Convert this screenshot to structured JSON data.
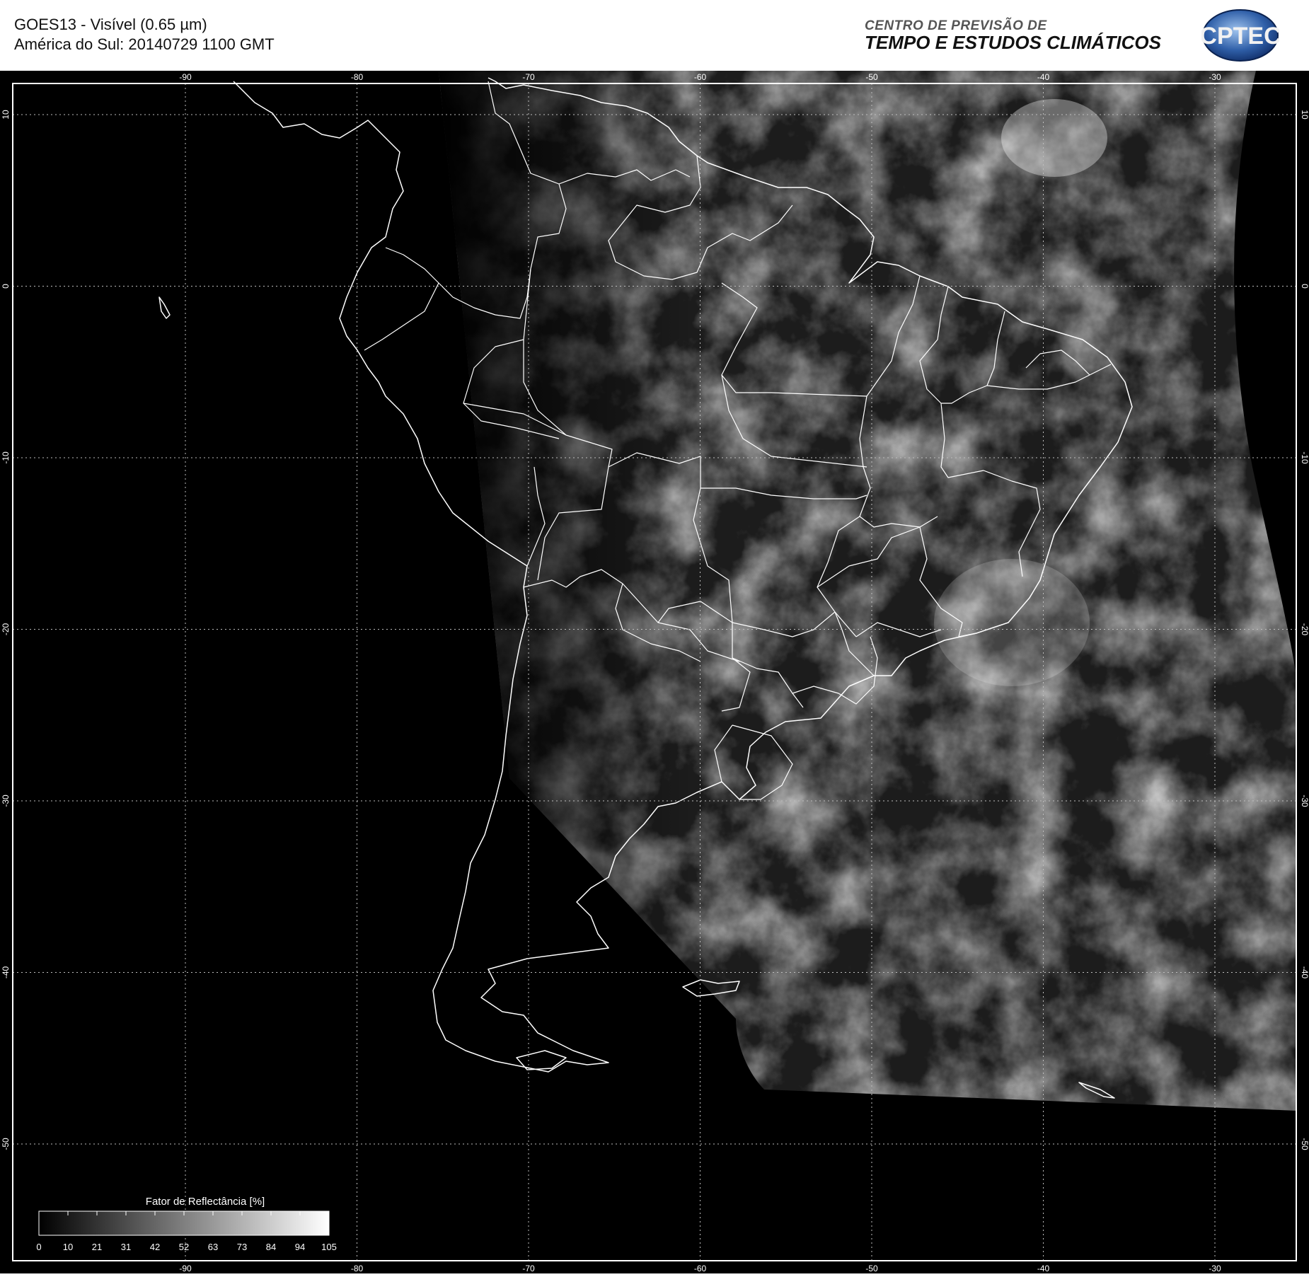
{
  "header": {
    "title_line1": "GOES13 - Visível (0.65 µm)",
    "title_line2": "América do Sul: 20140729 1100 GMT",
    "org_line1": "CENTRO DE PREVISÃO DE",
    "org_line2": "TEMPO E ESTUDOS CLIMÁTICOS",
    "logo_text": "CPTEC"
  },
  "map": {
    "lon_ticks": [
      "-90",
      "-80",
      "-70",
      "-60",
      "-50",
      "-40",
      "-30"
    ],
    "lat_ticks": [
      "10",
      "0",
      "-10",
      "-20",
      "-30",
      "-40",
      "-50"
    ],
    "lon_values": [
      -90,
      -80,
      -70,
      -60,
      -50,
      -40,
      -30
    ],
    "lat_values": [
      10,
      0,
      -10,
      -20,
      -30,
      -40,
      -50
    ],
    "background_color": "#000000",
    "line_color": "#ffffff"
  },
  "legend": {
    "title": "Fator de Reflectância [%]",
    "labels": [
      "0",
      "10",
      "21",
      "31",
      "42",
      "52",
      "63",
      "73",
      "84",
      "94",
      "105"
    ]
  }
}
